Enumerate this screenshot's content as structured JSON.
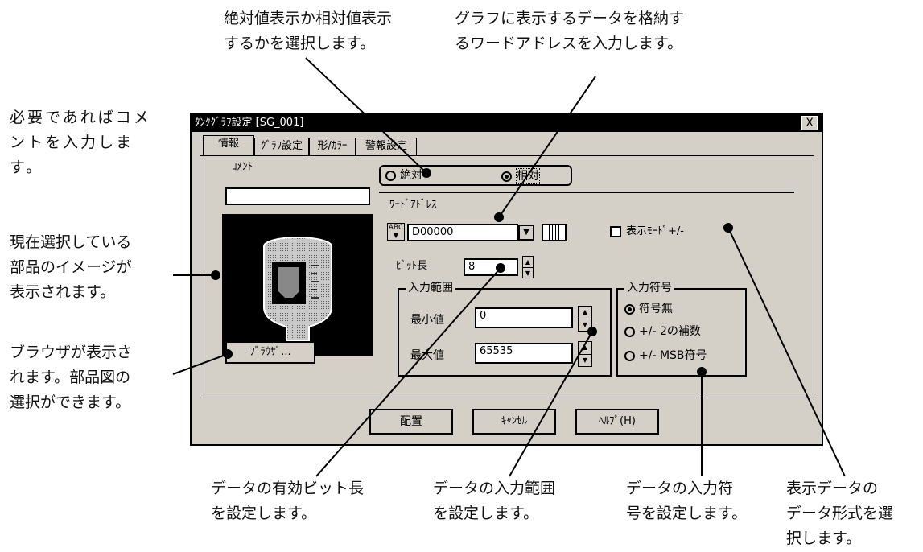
{
  "annotations": {
    "abs_rel": "絶対値表示か相対値表示\nするかを選択します。",
    "word_address": "グラフに表示するデータを格納す\nるワードアドレスを入力します。",
    "comment": "必要であればコメ\nントを入力しま\nす。",
    "image": "現在選択している\n部品のイメージが\n表示されます。",
    "browser": "ブラウザが表示さ\nれます。部品図の\n選択ができます。",
    "bit_length": "データの有効ビット長\nを設定します。",
    "input_range": "データの入力範囲\nを設定します。",
    "input_sign": "データの入力符\n号を設定します。",
    "display_format": "表示データの\nデータ形式を選\n択します。"
  },
  "dialog": {
    "title": "ﾀﾝｸｸﾞﾗﾌ設定 [SG_001]",
    "close_label": "X",
    "tabs": [
      "情報",
      "ｸﾞﾗﾌ設定",
      "形/ｶﾗｰ",
      "警報設定"
    ],
    "comment_label": "ｺﾒﾝﾄ",
    "comment_value": "",
    "browse_label": "ﾌﾞﾗｳｻﾞ...",
    "mode_absolute": "絶対",
    "mode_relative": "相対",
    "mode_selected": "相対",
    "word_address_label": "ﾜｰﾄﾞｱﾄﾞﾚｽ",
    "word_address_value": "D00000",
    "display_mode_label": "表示ﾓｰﾄﾞ+/-",
    "bit_length_label": "ﾋﾞｯﾄ長",
    "bit_length_value": "8",
    "range_group_label": "入力範囲",
    "min_label": "最小値",
    "min_value": "0",
    "max_label": "最大値",
    "max_value": "65535",
    "sign_group_label": "入力符号",
    "sign_options": [
      "符号無",
      "+/- 2の補数",
      "+/- MSB符号"
    ],
    "sign_selected": "符号無",
    "place_button": "配置",
    "cancel_button": "ｷｬﾝｾﾙ",
    "help_button": "ﾍﾙﾌﾟ(H)"
  }
}
